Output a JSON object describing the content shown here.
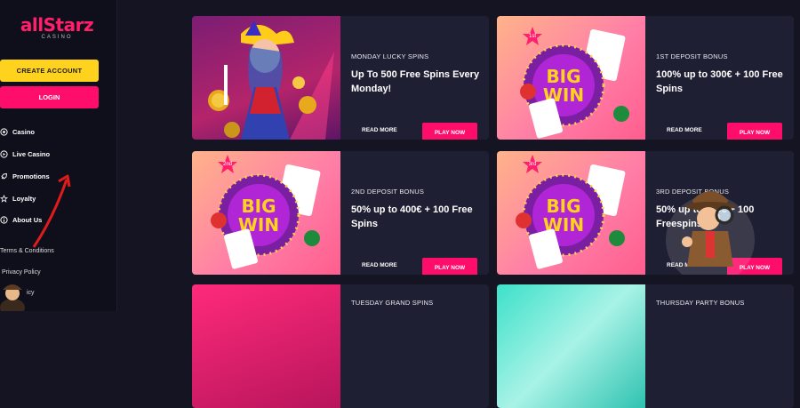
{
  "sidebar": {
    "logo": {
      "brand": "allStarz",
      "sub": "CASINO"
    },
    "create_account": "CREATE ACCOUNT",
    "login": "LOGIN",
    "nav": [
      {
        "label": "Casino",
        "icon": "casino-chip-icon"
      },
      {
        "label": "Live Casino",
        "icon": "live-casino-icon"
      },
      {
        "label": "Promotions",
        "icon": "rocket-icon"
      },
      {
        "label": "Loyalty",
        "icon": "star-badge-icon"
      },
      {
        "label": "About Us",
        "icon": "info-icon"
      }
    ],
    "footer_links": [
      "Terms & Conditions",
      "Privacy Policy",
      "icy"
    ]
  },
  "promos": [
    {
      "category": "MONDAY LUCKY SPINS",
      "headline": "Up To 500 Free Spins Every Monday!",
      "read_more": "READ MORE",
      "play": "PLAY NOW"
    },
    {
      "category": "1ST DEPOSIT BONUS",
      "headline": "100% up to 300€ + 100 Free Spins",
      "read_more": "READ MORE",
      "play": "PLAY NOW",
      "badge": "1st"
    },
    {
      "category": "2ND DEPOSIT BONUS",
      "headline": "50% up to 400€ + 100 Free Spins",
      "read_more": "READ MORE",
      "play": "PLAY NOW",
      "badge": "2nd"
    },
    {
      "category": "3RD DEPOSIT BONUS",
      "headline": "50% up to 500€ + 100 Freespins",
      "read_more": "READ MORE",
      "play": "PLAY NOW",
      "badge": "3rd"
    },
    {
      "category": "TUESDAY GRAND SPINS"
    },
    {
      "category": "THURSDAY PARTY BONUS"
    }
  ],
  "bigwin_text": [
    "BIG",
    "WIN"
  ],
  "colors": {
    "accent": "#ff0d6a",
    "yellow": "#ffd21e",
    "bg": "#141423",
    "card": "#1f1f33"
  }
}
